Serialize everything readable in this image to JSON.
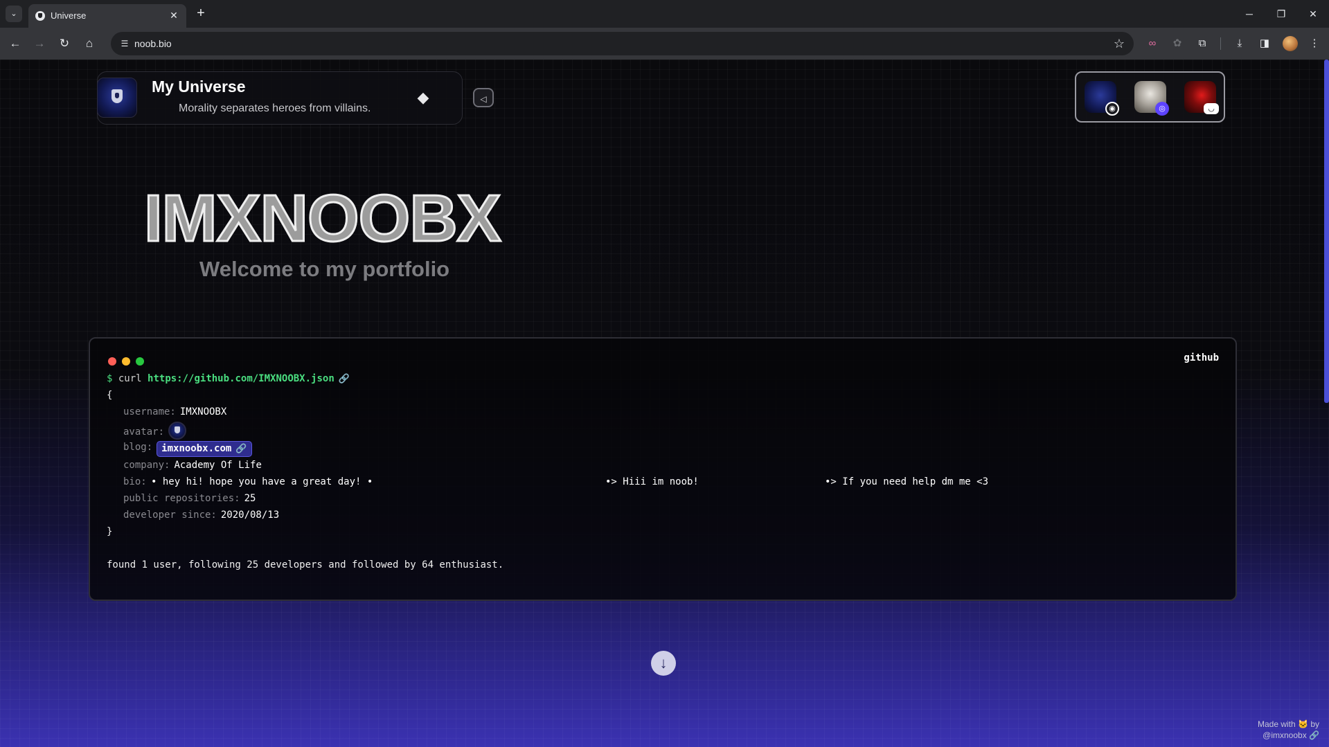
{
  "browser": {
    "tab_title": "Universe",
    "tab_close": "✕",
    "new_tab": "+",
    "url": "noob.bio",
    "window": {
      "minimize": "─",
      "maximize": "❐",
      "close": "✕"
    }
  },
  "header": {
    "title": "My Universe",
    "tagline": "Morality separates heroes from villains.",
    "theme_toggle_icon": "◆",
    "collapse_icon": "◁"
  },
  "social": {
    "links": [
      {
        "platform": "github",
        "badge": "◉"
      },
      {
        "platform": "profile",
        "badge": "◎"
      },
      {
        "platform": "discord",
        "badge": "◡"
      }
    ]
  },
  "hero": {
    "name": "IMXNOOBX",
    "subtitle": "Welcome to my portfolio"
  },
  "terminal": {
    "label": "github",
    "prompt": "$",
    "command": "curl",
    "url": "https://github.com/IMXNOOBX.json",
    "link_icon": "🔗",
    "open_brace": "{",
    "close_brace": "}",
    "fields": {
      "username_key": "username:",
      "username": "IMXNOOBX",
      "avatar_key": "avatar:",
      "blog_key": "blog:",
      "blog": "imxnoobx.com",
      "company_key": "company:",
      "company": "Academy Of Life",
      "bio_key": "bio:",
      "bio_1": "• hey hi! hope you have a great day! •",
      "bio_2": "•> Hiii im noob!",
      "bio_3": "•> If you need help dm me <3",
      "repos_key": "public repositories:",
      "repos": "25",
      "since_key": "developer since:",
      "since": "2020/08/13"
    },
    "summary": "found 1 user, following 25 developers and followed by 64 enthusiast."
  },
  "footer": {
    "scroll_down_icon": "↓",
    "made_with_prefix": "Made with",
    "made_with_icon": "🐱",
    "made_with_by": "by",
    "author": "@imxnoobx",
    "author_link_icon": "🔗"
  },
  "colors": {
    "accent": "#4b4fd6",
    "prompt_green": "#4ade80",
    "blog_chip": "#2f2d8f"
  }
}
